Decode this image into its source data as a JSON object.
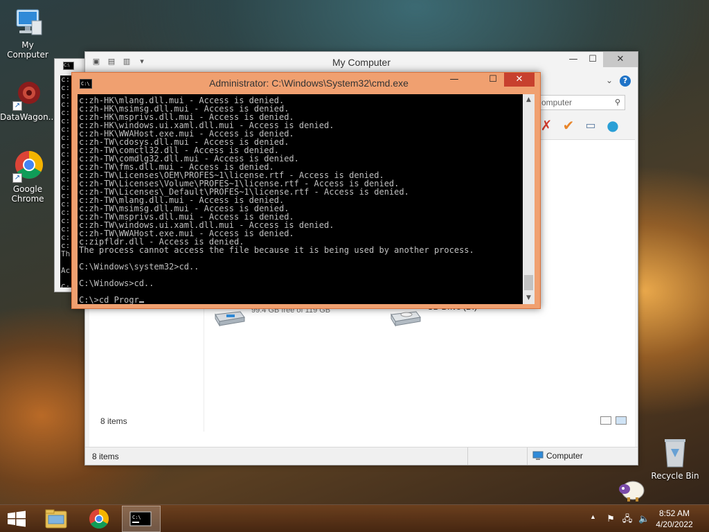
{
  "desktop": {
    "icons": [
      {
        "label": "My Computer"
      },
      {
        "label": "DataWagon..."
      },
      {
        "label": "Google Chrome"
      },
      {
        "label": "Recycle Bin"
      }
    ]
  },
  "explorer": {
    "title": "My Computer",
    "search_placeholder": "omputer",
    "drives": [
      {
        "free": "99.4 GB free of 119 GB",
        "used_fraction": 0.165
      },
      {
        "name": "CD Drive (D:)"
      }
    ],
    "items_count": "8 items",
    "status_items": "8 items",
    "status_zone": "Computer"
  },
  "back_cmd": {
    "lines": [
      "c:",
      "c:",
      "c:",
      "c:",
      "c:",
      "c:",
      "c:",
      "c:",
      "c:",
      "c:",
      "c:",
      "c:",
      "c:",
      "c:",
      "c:",
      "c:",
      "c:",
      "c:",
      "c:",
      "c:",
      "c:",
      "Th",
      "",
      "Ac",
      "",
      "C:"
    ]
  },
  "cmd": {
    "title": "Administrator: C:\\Windows\\System32\\cmd.exe",
    "output": "c:zh-HK\\mlang.dll.mui - Access is denied.\nc:zh-HK\\msimsg.dll.mui - Access is denied.\nc:zh-HK\\msprivs.dll.mui - Access is denied.\nc:zh-HK\\windows.ui.xaml.dll.mui - Access is denied.\nc:zh-HK\\WWAHost.exe.mui - Access is denied.\nc:zh-TW\\cdosys.dll.mui - Access is denied.\nc:zh-TW\\comctl32.dll - Access is denied.\nc:zh-TW\\comdlg32.dll.mui - Access is denied.\nc:zh-TW\\fms.dll.mui - Access is denied.\nc:zh-TW\\Licenses\\OEM\\PROFES~1\\license.rtf - Access is denied.\nc:zh-TW\\Licenses\\Volume\\PROFES~1\\license.rtf - Access is denied.\nc:zh-TW\\Licenses\\_Default\\PROFES~1\\license.rtf - Access is denied.\nc:zh-TW\\mlang.dll.mui - Access is denied.\nc:zh-TW\\msimsg.dll.mui - Access is denied.\nc:zh-TW\\msprivs.dll.mui - Access is denied.\nc:zh-TW\\windows.ui.xaml.dll.mui - Access is denied.\nc:zh-TW\\WWAHost.exe.mui - Access is denied.\nc:zipfldr.dll - Access is denied.\nThe process cannot access the file because it is being used by another process.\n\nC:\\Windows\\system32>cd..\n\nC:\\Windows>cd..\n\nC:\\>cd Progr",
    "minimize": "—",
    "maximize": "☐",
    "close": "✕"
  },
  "taskbar": {
    "time": "8:52 AM",
    "date": "4/20/2022"
  },
  "icons": {
    "my_computer": "computer-icon",
    "datawagon": "datawagon-icon",
    "chrome": "chrome-icon",
    "recycle": "recycle-bin-icon",
    "start": "windows-logo-icon"
  },
  "colors": {
    "cmd_frame": "#f0a070",
    "cmd_close": "#c7402e",
    "drive_bar": "#26a0da"
  }
}
